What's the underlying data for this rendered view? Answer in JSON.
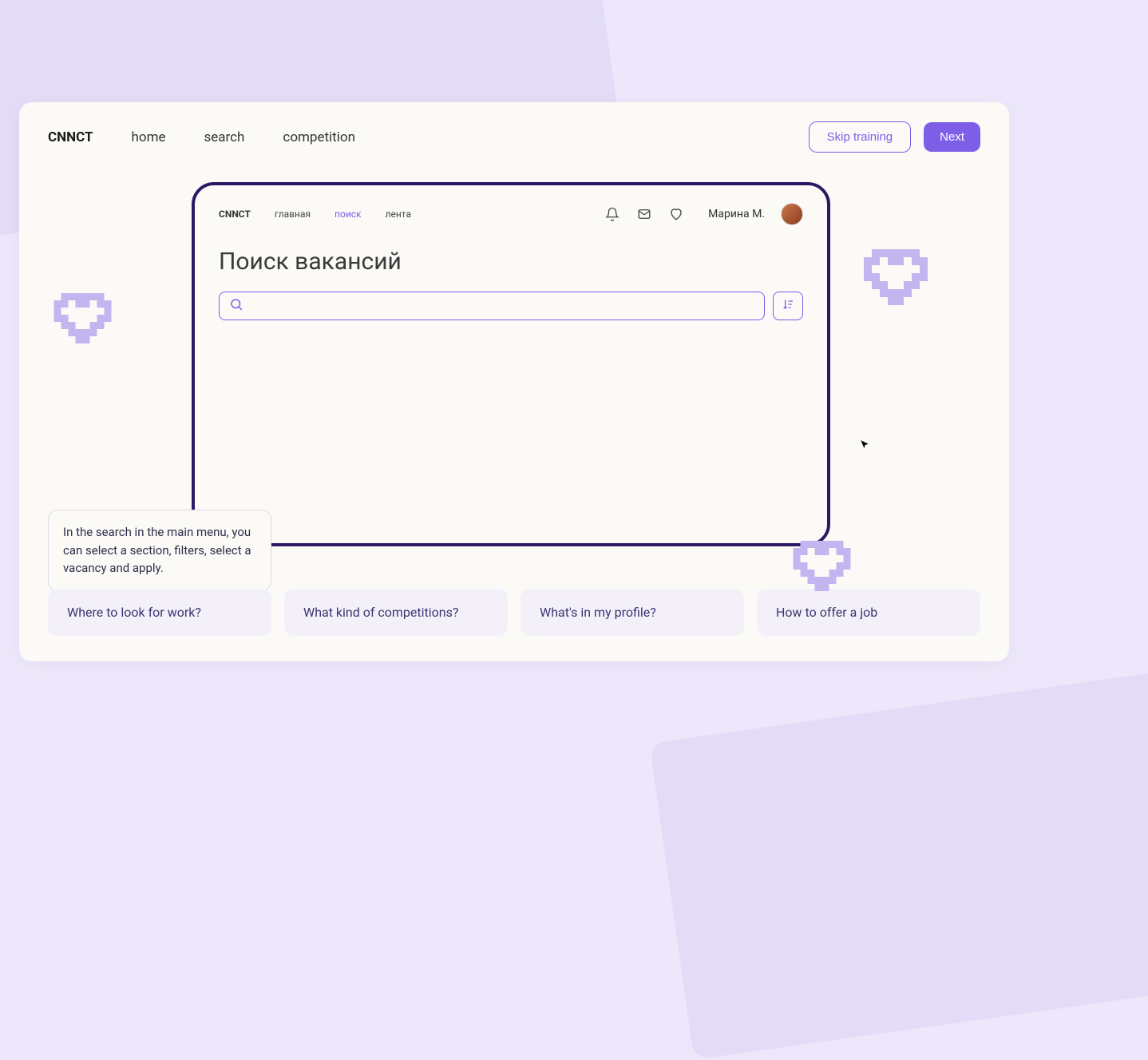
{
  "nav": {
    "brand": "CNNCT",
    "links": [
      "home",
      "search",
      "competition"
    ],
    "skip_label": "Skip training",
    "next_label": "Next"
  },
  "inner": {
    "brand": "CNNCT",
    "links": [
      {
        "label": "главная",
        "active": false
      },
      {
        "label": "поиск",
        "active": true
      },
      {
        "label": "лента",
        "active": false
      }
    ],
    "username": "Марина М.",
    "page_title": "Поиск вакансий",
    "search_placeholder": ""
  },
  "tooltip": {
    "text": "In the search in the main menu, you can select a section, filters, select a vacancy and apply."
  },
  "faq": [
    "Where to look for work?",
    "What kind of competitions?",
    "What's in my profile?",
    "How to offer a job"
  ],
  "colors": {
    "accent": "#7c5fe6",
    "dark_border": "#2d1866",
    "bg": "#ece7fa",
    "card": "#fbfaf7"
  }
}
